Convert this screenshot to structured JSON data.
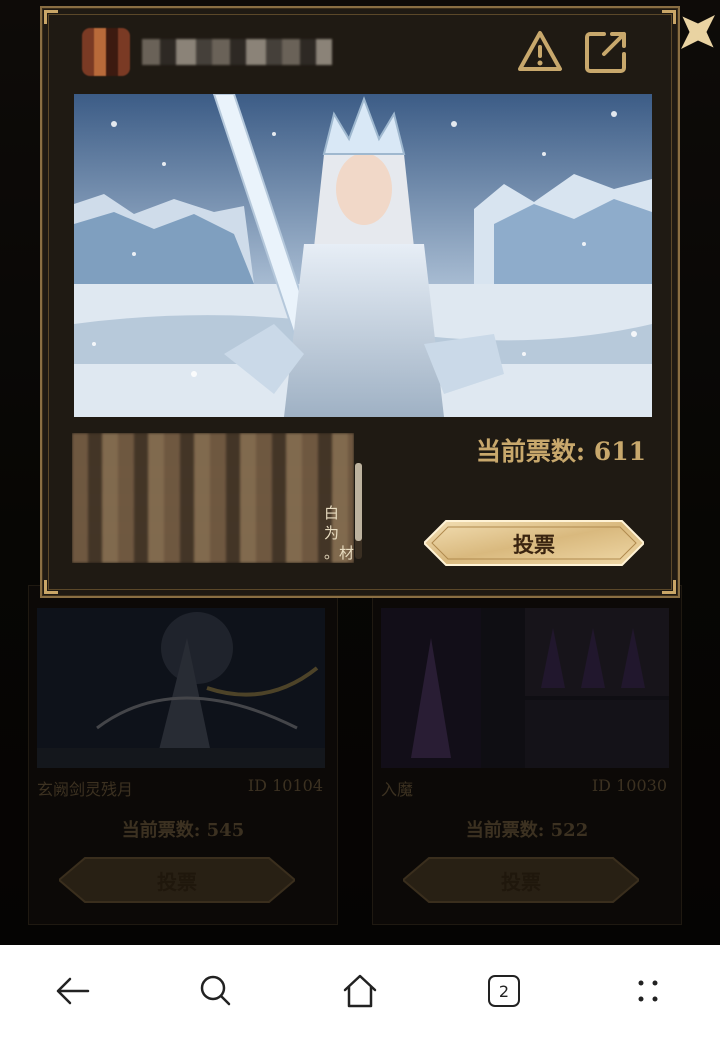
{
  "modal": {
    "votes_label": "当前票数: 611",
    "vote_button": "投票",
    "description_edge_text": "白\n为\n。材"
  },
  "cards": [
    {
      "title": "玄阙剑灵残月",
      "id_label": "ID 10104",
      "votes_label": "当前票数: 545",
      "vote_button": "投票"
    },
    {
      "title": "入魔",
      "id_label": "ID 10030",
      "votes_label": "当前票数: 522",
      "vote_button": "投票"
    }
  ],
  "nav": {
    "tab_count": "2"
  },
  "icons": {
    "report": "warning-triangle-icon",
    "share": "external-link-icon",
    "close": "star-close-icon",
    "back": "arrow-left-icon",
    "search": "search-icon",
    "home": "home-icon",
    "tabs": "tabs-icon",
    "menu": "dots-menu-icon"
  },
  "colors": {
    "gold": "#c8a86c",
    "frame": "#8a6f43",
    "modal_bg": "#1f1a13"
  }
}
